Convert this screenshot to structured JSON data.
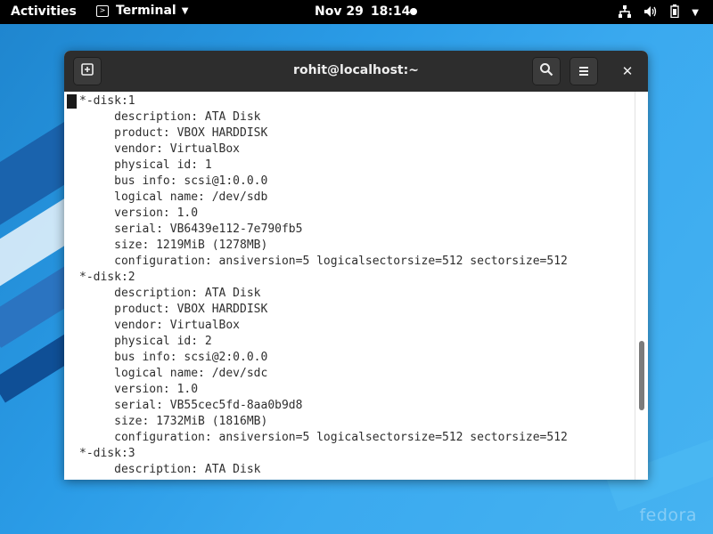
{
  "topbar": {
    "activities": "Activities",
    "app_menu_label": "Terminal",
    "date": "Nov 29",
    "time": "18:14"
  },
  "window": {
    "title": "rohit@localhost:~"
  },
  "terminal": {
    "lines": [
      "*-disk:1",
      "     description: ATA Disk",
      "     product: VBOX HARDDISK",
      "     vendor: VirtualBox",
      "     physical id: 1",
      "     bus info: scsi@1:0.0.0",
      "     logical name: /dev/sdb",
      "     version: 1.0",
      "     serial: VB6439e112-7e790fb5",
      "     size: 1219MiB (1278MB)",
      "     configuration: ansiversion=5 logicalsectorsize=512 sectorsize=512",
      "*-disk:2",
      "     description: ATA Disk",
      "     product: VBOX HARDDISK",
      "     vendor: VirtualBox",
      "     physical id: 2",
      "     bus info: scsi@2:0.0.0",
      "     logical name: /dev/sdc",
      "     version: 1.0",
      "     serial: VB55cec5fd-8aa0b9d8",
      "     size: 1732MiB (1816MB)",
      "     configuration: ansiversion=5 logicalsectorsize=512 sectorsize=512",
      "*-disk:3",
      "     description: ATA Disk"
    ]
  },
  "desktop": {
    "logo_text": "fedora"
  },
  "icons": {
    "app": "terminal-app-icon",
    "network": "network-icon",
    "volume": "volume-icon",
    "battery": "battery-icon",
    "system_menu": "chevron-down-icon",
    "new_tab": "new-tab-icon",
    "search": "search-icon",
    "menu": "hamburger-menu-icon",
    "close": "close-icon"
  },
  "colors": {
    "topbar": "#000000",
    "headerbar": "#2d2d2d",
    "terminal_bg": "#ffffff",
    "terminal_fg": "#2e2e2e",
    "desktop": "#2a9be6"
  }
}
